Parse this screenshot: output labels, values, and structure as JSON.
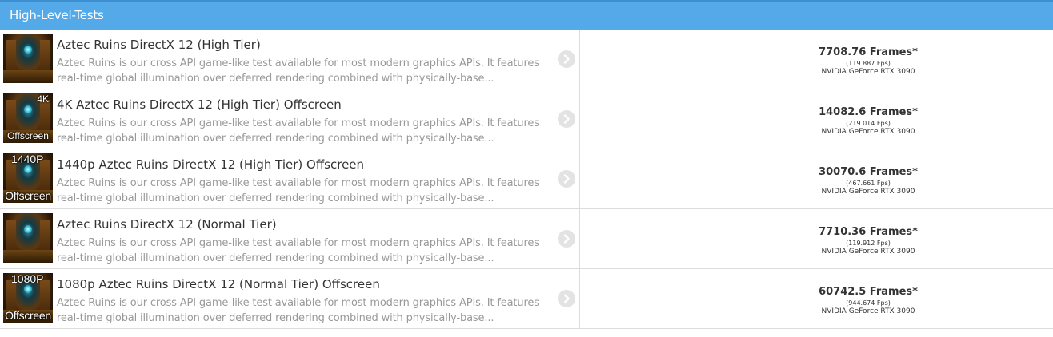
{
  "header": {
    "title": "High-Level-Tests"
  },
  "tests": [
    {
      "title": "Aztec Ruins DirectX 12 (High Tier)",
      "description": "Aztec Ruins is our cross API game-like test available for most modern graphics APIs. It features real-time global illumination over deferred rendering combined with physically-base...",
      "thumb_top": "",
      "thumb_bottom": "",
      "frames": "7708.76 Frames*",
      "fps": "(119.887 Fps)",
      "gpu": "NVIDIA GeForce RTX 3090"
    },
    {
      "title": "4K Aztec Ruins DirectX 12 (High Tier) Offscreen",
      "description": "Aztec Ruins is our cross API game-like test available for most modern graphics APIs. It features real-time global illumination over deferred rendering combined with physically-base...",
      "thumb_top": "4K",
      "thumb_bottom": "Offscreen",
      "frames": "14082.6 Frames*",
      "fps": "(219.014 Fps)",
      "gpu": "NVIDIA GeForce RTX 3090"
    },
    {
      "title": "1440p Aztec Ruins DirectX 12 (High Tier) Offscreen",
      "description": "Aztec Ruins is our cross API game-like test available for most modern graphics APIs. It features real-time global illumination over deferred rendering combined with physically-base...",
      "thumb_top": "1440P",
      "thumb_bottom": "Offscreen",
      "frames": "30070.6 Frames*",
      "fps": "(467.661 Fps)",
      "gpu": "NVIDIA GeForce RTX 3090"
    },
    {
      "title": "Aztec Ruins DirectX 12 (Normal Tier)",
      "description": "Aztec Ruins is our cross API game-like test available for most modern graphics APIs. It features real-time global illumination over deferred rendering combined with physically-base...",
      "thumb_top": "",
      "thumb_bottom": "",
      "frames": "7710.36 Frames*",
      "fps": "(119.912 Fps)",
      "gpu": "NVIDIA GeForce RTX 3090"
    },
    {
      "title": "1080p Aztec Ruins DirectX 12 (Normal Tier) Offscreen",
      "description": "Aztec Ruins is our cross API game-like test available for most modern graphics APIs. It features real-time global illumination over deferred rendering combined with physically-base...",
      "thumb_top": "1080P",
      "thumb_bottom": "Offscreen",
      "frames": "60742.5 Frames*",
      "fps": "(944.674 Fps)",
      "gpu": "NVIDIA GeForce RTX 3090"
    }
  ]
}
